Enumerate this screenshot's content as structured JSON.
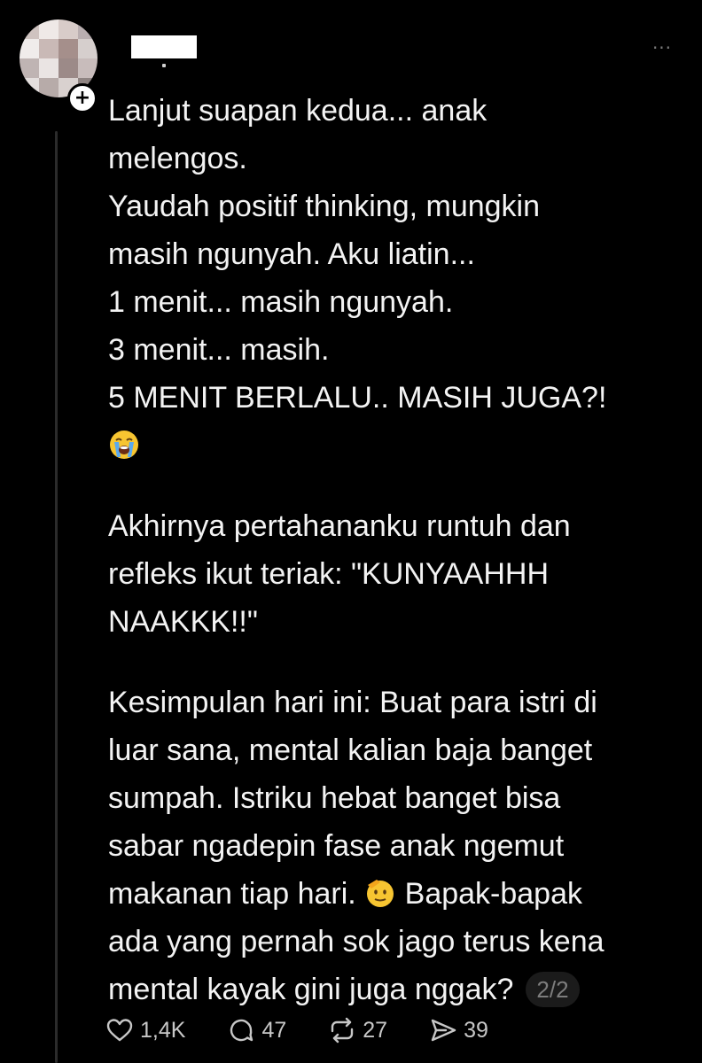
{
  "post": {
    "paragraphs": [
      [
        "Lanjut suapan kedua... anak",
        "melengos.",
        "Yaudah positif thinking, mungkin",
        "masih ngunyah. Aku liatin...",
        "1 menit... masih ngunyah.",
        "3 menit... masih.",
        "5 MENIT BERLALU.. MASIH JUGA?!"
      ],
      [
        "Akhirnya pertahananku runtuh dan",
        "refleks ikut teriak: \"KUNYAAHHH",
        "NAAKKK!!\""
      ],
      [
        "Kesimpulan hari ini: Buat para istri di",
        "luar sana, mental kalian baja banget",
        "sumpah. Istriku hebat banget bisa",
        "sabar ngadepin fase anak ngemut",
        "makanan tiap hari.",
        "Bapak-bapak",
        "ada yang pernah sok jago terus kena",
        "mental kayak gini juga nggak?"
      ]
    ],
    "emojis": {
      "crying": "loudly-crying-face-icon",
      "saluting": "saluting-face-icon"
    },
    "thread_counter": "2/2",
    "follow_symbol": "+",
    "more_symbol": "···"
  },
  "actions": {
    "likes": "1,4K",
    "replies": "47",
    "reposts": "27",
    "shares": "39"
  },
  "colors": {
    "background": "#000000",
    "text": "#f3f3f3",
    "muted": "#7d7d7d",
    "thread_line": "#2b2b2b"
  }
}
